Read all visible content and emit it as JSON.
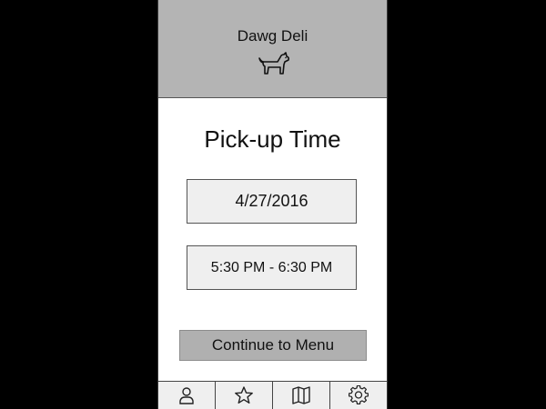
{
  "header": {
    "app_name": "Dawg Deli",
    "logo_icon": "dog-icon"
  },
  "main": {
    "title": "Pick-up Time",
    "date_value": "4/27/2016",
    "time_value": "5:30 PM - 6:30 PM",
    "continue_label": "Continue to Menu"
  },
  "tabbar": {
    "tabs": [
      {
        "icon": "profile-icon"
      },
      {
        "icon": "star-icon"
      },
      {
        "icon": "map-icon"
      },
      {
        "icon": "settings-gear-icon"
      }
    ]
  },
  "colors": {
    "background": "#000000",
    "header_bg": "#b4b4b4",
    "field_bg": "#efefef",
    "button_bg": "#b0b0b0"
  }
}
